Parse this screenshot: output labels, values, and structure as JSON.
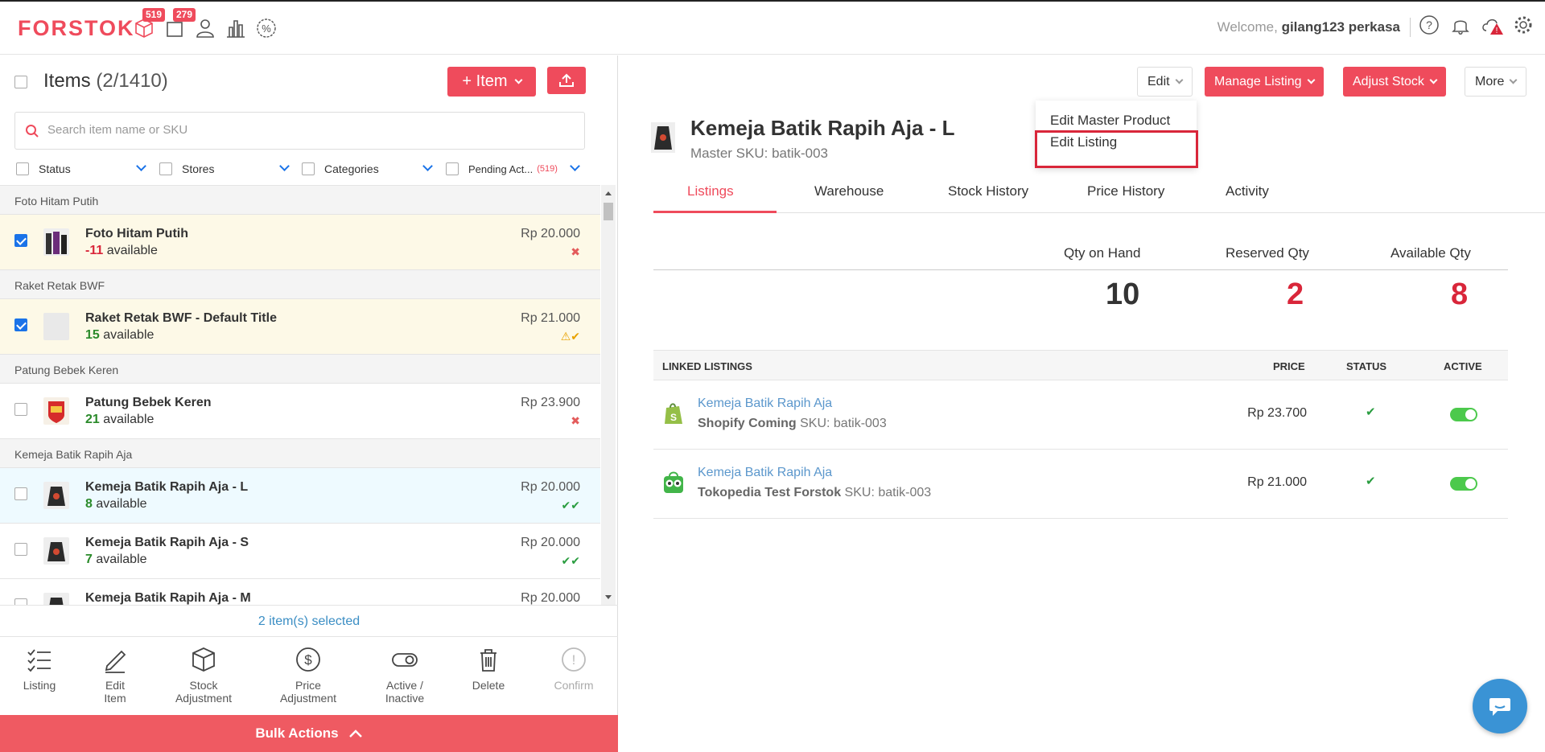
{
  "topbar": {
    "logo": "FORSTOK",
    "badges": {
      "orders": "519",
      "packages": "279"
    },
    "welcome_prefix": "Welcome,",
    "user": "gilang123 perkasa"
  },
  "left": {
    "title": "Items",
    "count": "(2/1410)",
    "add_item_label": "+ Item",
    "search_placeholder": "Search item name or SKU",
    "filters": {
      "status": "Status",
      "stores": "Stores",
      "categories": "Categories",
      "pending": "Pending Act...",
      "pending_count": "(519)"
    },
    "groups": [
      {
        "label": "Foto Hitam Putih",
        "rows": [
          {
            "name": "Foto Hitam Putih",
            "qty": "-11",
            "avail": "available",
            "price": "Rp 20.000",
            "mark": "✖",
            "checked": true
          }
        ]
      },
      {
        "label": "Raket Retak BWF",
        "rows": [
          {
            "name": "Raket Retak BWF - Default Title",
            "qty": "15",
            "avail": "available",
            "price": "Rp 21.000",
            "mark": "⚠✔",
            "checked": true
          }
        ]
      },
      {
        "label": "Patung Bebek Keren",
        "rows": [
          {
            "name": "Patung Bebek Keren",
            "qty": "21",
            "avail": "available",
            "price": "Rp 23.900",
            "mark": "✖",
            "checked": false
          }
        ]
      },
      {
        "label": "Kemeja Batik Rapih Aja",
        "rows": [
          {
            "name": "Kemeja Batik Rapih Aja - L",
            "qty": "8",
            "avail": "available",
            "price": "Rp 20.000",
            "mark": "✔✔",
            "checked": false
          },
          {
            "name": "Kemeja Batik Rapih Aja - S",
            "qty": "7",
            "avail": "available",
            "price": "Rp 20.000",
            "mark": "✔✔",
            "checked": false
          },
          {
            "name": "Kemeja Batik Rapih Aja - M",
            "qty": "",
            "avail": "",
            "price": "Rp 20.000",
            "mark": "",
            "checked": false
          }
        ]
      }
    ],
    "selected_text": "2 item(s) selected",
    "bulk_actions": {
      "listing": "Listing",
      "edit_item": "Edit Item",
      "stock_adjustment": "Stock Adjustment",
      "price_adjustment": "Price Adjustment",
      "active_inactive": "Active / Inactive",
      "delete": "Delete",
      "confirm": "Confirm"
    },
    "bulk_button": "Bulk Actions"
  },
  "right": {
    "buttons": {
      "edit": "Edit",
      "manage_listing": "Manage Listing",
      "adjust_stock": "Adjust Stock",
      "more": "More"
    },
    "edit_menu": {
      "edit_master": "Edit Master Product",
      "edit_listing": "Edit Listing"
    },
    "product": {
      "name": "Kemeja Batik Rapih Aja - L",
      "master_sku": "Master SKU: batik-003"
    },
    "tabs": [
      "Listings",
      "Warehouse",
      "Stock History",
      "Price History",
      "Activity"
    ],
    "qty": {
      "on_hand_label": "Qty on Hand",
      "on_hand": "10",
      "reserved_label": "Reserved Qty",
      "reserved": "2",
      "available_label": "Available Qty",
      "available": "8"
    },
    "linked": {
      "headers": {
        "listings": "LINKED LISTINGS",
        "price": "PRICE",
        "status": "STATUS",
        "active": "ACTIVE"
      },
      "rows": [
        {
          "name": "Kemeja Batik Rapih Aja",
          "store": "Shopify Coming",
          "sku": "SKU: batik-003",
          "price": "Rp  23.700",
          "status": "✔",
          "logo": "shopify-icon"
        },
        {
          "name": "Kemeja Batik Rapih Aja",
          "store": "Tokopedia Test Forstok",
          "sku": "SKU: batik-003",
          "price": "Rp  21.000",
          "status": "✔",
          "logo": "tokopedia-icon"
        }
      ]
    }
  },
  "colors": {
    "brand": "#ef4b5c",
    "link": "#5b97cc",
    "ok": "#2a9d40",
    "highlight": "#d9263a"
  }
}
